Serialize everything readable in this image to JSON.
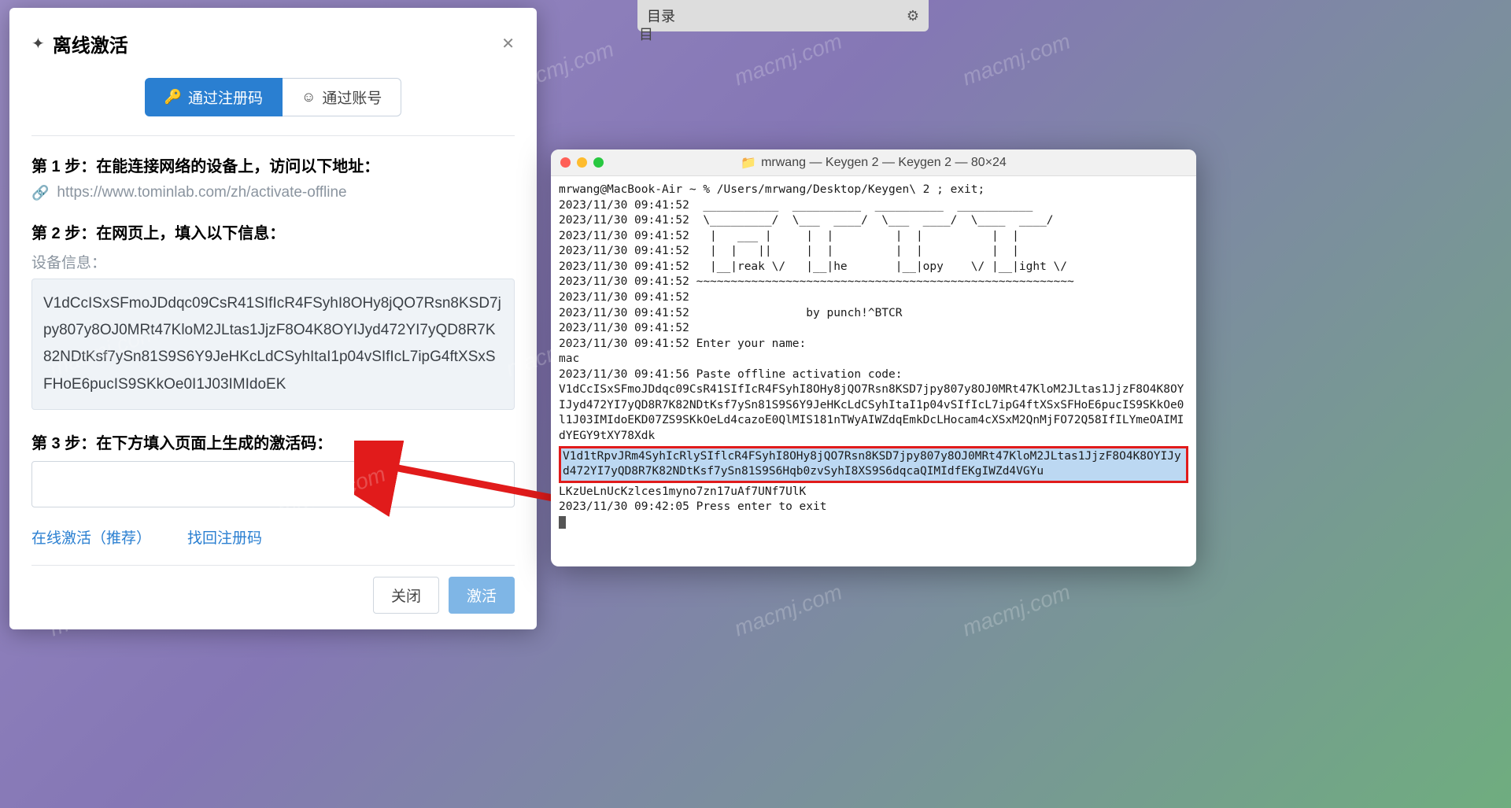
{
  "bg_tab": {
    "label": "目录",
    "outer_label": "目"
  },
  "dialog": {
    "title": "离线激活",
    "tabs": {
      "by_code": "通过注册码",
      "by_account": "通过账号"
    },
    "step1_title": "第 1 步：在能连接网络的设备上，访问以下地址：",
    "url": "https://www.tominlab.com/zh/activate-offline",
    "step2_title": "第 2 步：在网页上，填入以下信息：",
    "device_label": "设备信息：",
    "device_info": "V1dCcISxSFmoJDdqc09CsR41SIfIcR4FSyhI8OHy8jQO7Rsn8KSD7jpy807y8OJ0MRt47KloM2JLtas1JjzF8O4K8OYIJyd472YI7yQD8R7K82NDtKsf7ySn81S9S6Y9JeHKcLdCSyhItaI1p04vSIfIcL7ipG4ftXSxSFHoE6pucIS9SKkOe0I1J03IMIdoEK",
    "step3_title": "第 3 步：在下方填入页面上生成的激活码：",
    "activation_placeholder": "",
    "links": {
      "online": "在线激活（推荐）",
      "find_code": "找回注册码"
    },
    "buttons": {
      "close": "关闭",
      "activate": "激活"
    }
  },
  "terminal": {
    "title": "mrwang — Keygen 2 — Keygen 2 — 80×24",
    "line_cmd": "mrwang@MacBook-Air ~ % /Users/mrwang/Desktop/Keygen\\ 2 ; exit;",
    "art1": "2023/11/30 09:41:52  ___________  __________  __________  ___________",
    "art2": "2023/11/30 09:41:52  \\_________/  \\___  ____/  \\___  ____/  \\____  ____/",
    "art3": "2023/11/30 09:41:52   |   ___ |     |  |         |  |          |  |",
    "art4": "2023/11/30 09:41:52   |  |   ||     |  |         |  |          |  |",
    "art5": "2023/11/30 09:41:52   |__|reak \\/   |__|he       |__|opy    \\/ |__|ight \\/",
    "art6": "2023/11/30 09:41:52 ~~~~~~~~~~~~~~~~~~~~~~~~~~~~~~~~~~~~~~~~~~~~~~~~~~~~~~~",
    "blank1": "2023/11/30 09:41:52",
    "byline": "2023/11/30 09:41:52                 by punch!^BTCR",
    "blank2": "2023/11/30 09:41:52",
    "enter_name": "2023/11/30 09:41:52 Enter your name:",
    "name_val": "mac",
    "paste_code": "2023/11/30 09:41:56 Paste offline activation code:",
    "paste_val": "V1dCcISxSFmoJDdqc09CsR41SIfIcR4FSyhI8OHy8jQO7Rsn8KSD7jpy807y8OJ0MRt47KloM2JLtas1JjzF8O4K8OYIJyd472YI7yQD8R7K82NDtKsf7ySn81S9S6Y9JeHKcLdCSyhItaI1p04vSIfIcL7ipG4ftXSxSFHoE6pucIS9SKkOe0l1J03IMIdoEKD07ZS9SKkOeLd4cazoE0QlMIS181nTWyAIWZdqEmkDcLHocam4cXSxM2QnMjFO72Q58IfILYmeOAIMIdYEGY9tXY78Xdk",
    "highlighted": "V1d1tRpvJRm4SyhIcRlySIflcR4FSyhI8OHy8jQO7Rsn8KSD7jpy807y8OJ0MRt47KloM2JLtas1JjzF8O4K8OYIJyd472YI7yQD8R7K82NDtKsf7ySn81S9S6Hqb0zvSyhI8XS9S6dqcaQIMIdfEKgIWZd4VGYu",
    "after_highlight": "LKzUeLnUcKzlces1myno7zn17uAf7UNf7UlK",
    "exit_line": "2023/11/30 09:42:05 Press enter to exit"
  },
  "watermark": "macmj.com"
}
